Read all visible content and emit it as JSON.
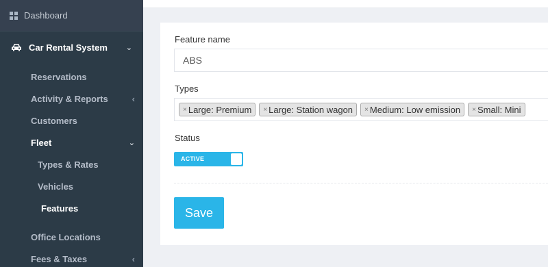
{
  "sidebar": {
    "dashboard": "Dashboard",
    "section": "Car Rental System",
    "items": {
      "reservations": "Reservations",
      "activity": "Activity & Reports",
      "customers": "Customers",
      "fleet": "Fleet",
      "types_rates": "Types & Rates",
      "vehicles": "Vehicles",
      "features": "Features",
      "office_locations": "Office Locations",
      "fees_taxes": "Fees & Taxes"
    },
    "active_item": "Features",
    "icons": {
      "dashboard": "dashboard-grid-icon",
      "section": "car-icon",
      "expanded": "chevron-down-icon",
      "collapsed": "chevron-left-icon"
    }
  },
  "form": {
    "feature_name_label": "Feature name",
    "feature_name_value": "ABS",
    "types_label": "Types",
    "types": [
      "Large: Premium",
      "Large: Station wagon",
      "Medium: Low emission",
      "Small: Mini"
    ],
    "tag_remove_glyph": "×",
    "status_label": "Status",
    "status_value": "ACTIVE",
    "save_label": "Save"
  },
  "colors": {
    "sidebar_bg": "#2c3b47",
    "accent": "#2ab5e8",
    "page_bg": "#eef0f4"
  }
}
